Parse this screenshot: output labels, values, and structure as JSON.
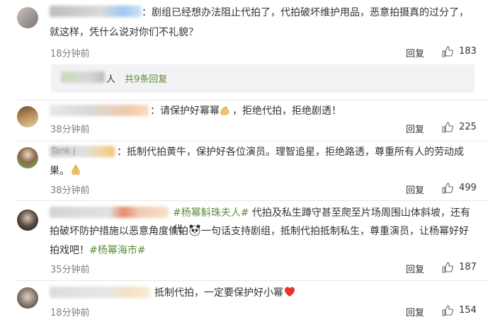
{
  "comments": [
    {
      "text_parts": [
        "：剧组已经想办法阻止代拍了，代拍破坏维护用品，恶意拍摄真的过分了，",
        "就这样，凭什么说对你们不礼貌？"
      ],
      "time": "18分钟前",
      "reply": "回复",
      "likes": "183",
      "subreply": {
        "prefix": "人",
        "more": "共9条回复"
      }
    },
    {
      "text": "：请保护好幂幂",
      "text2": "，拒绝代拍，拒绝剧透！",
      "emoji": "flexed-biceps-icon",
      "time": "38分钟前",
      "reply": "回复",
      "likes": "225"
    },
    {
      "name_visible": "Tank j",
      "text_parts": [
        "：抵制代拍黄牛，保护好各位演员。理智追星，拒绝路透，尊重所有人的劳动成",
        "果。"
      ],
      "emoji": "praying-hands-icon",
      "time": "38分钟前",
      "reply": "回复",
      "likes": "499"
    },
    {
      "hashtag1": "#杨幂斛珠夫人#",
      "text1": "代拍及私生蹲守甚至爬至片场周围山体斜坡，还有代",
      "text2a": "拍破坏防护措施以恶意角度偷拍",
      "text2b": "一句话支持剧组，抵制代拍抵制私生，尊重演员，让杨幂好好",
      "text3": "拍戏吧！",
      "hashtag2": "#杨幂海市#",
      "emoji": "panda-icon",
      "time": "35分钟前",
      "reply": "回复",
      "likes": "187"
    },
    {
      "text": "抵制代拍，一定要保护好小幂",
      "emoji": "red-heart-icon",
      "time": "18分钟前",
      "reply": "回复",
      "likes": "154"
    }
  ],
  "colors": {
    "link_green": "#5f8c3d",
    "muted": "#808080",
    "divider": "#e6e6e6",
    "subreply_bg": "#f2f2f5"
  }
}
